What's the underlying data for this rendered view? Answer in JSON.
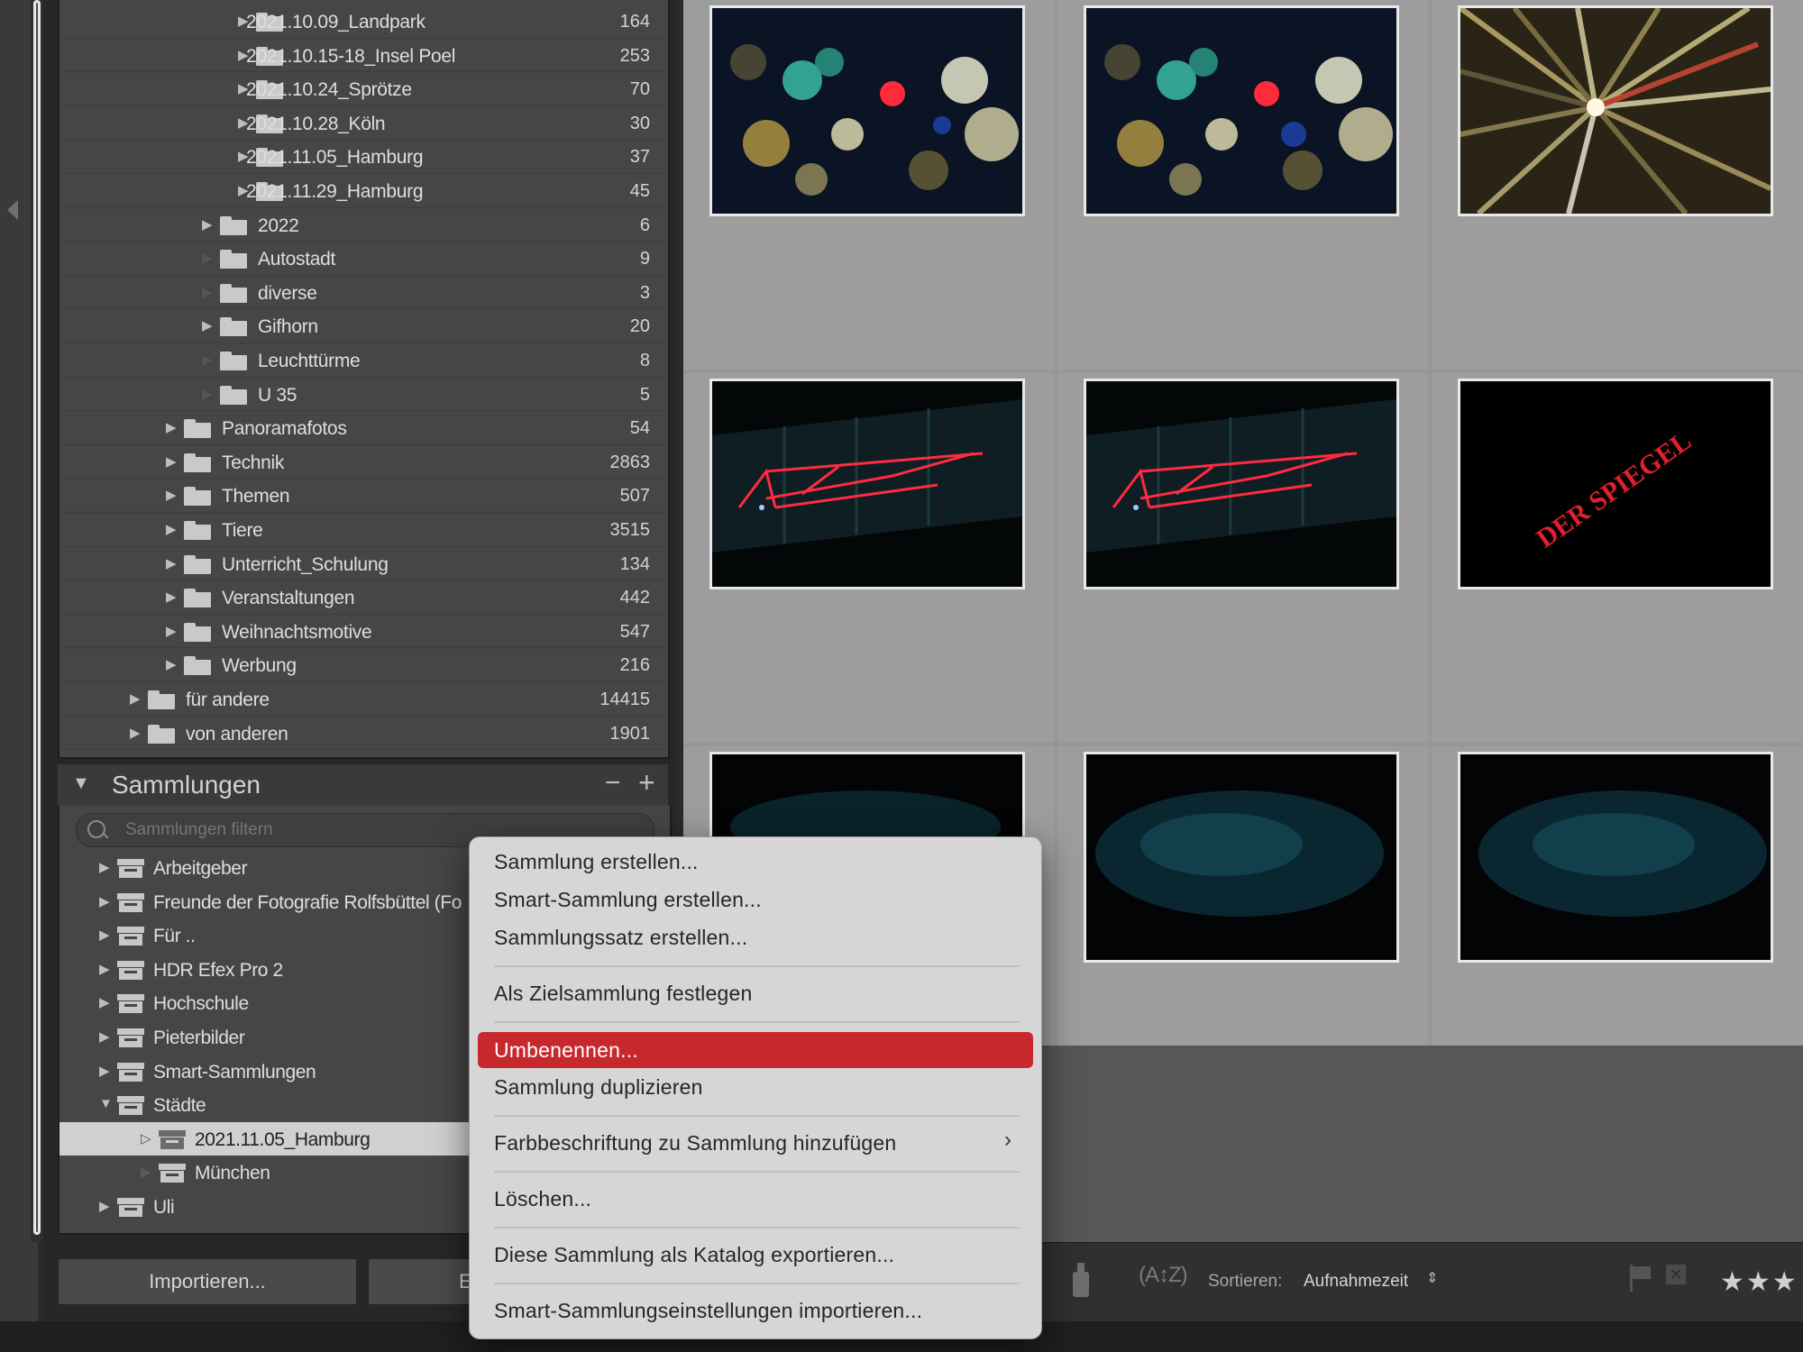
{
  "folders": [
    {
      "label": "2021.10.09_Landpark",
      "count": "164"
    },
    {
      "label": "2021.10.15-18_Insel Poel",
      "count": "253"
    },
    {
      "label": "2021.10.24_Sprötze",
      "count": "70"
    },
    {
      "label": "2021.10.28_Köln",
      "count": "30"
    },
    {
      "label": "2021.11.05_Hamburg",
      "count": "37"
    },
    {
      "label": "2021.11.29_Hamburg",
      "count": "45"
    },
    {
      "label": "2022",
      "count": "6"
    },
    {
      "label": "Autostadt",
      "count": "9"
    },
    {
      "label": "diverse",
      "count": "3"
    },
    {
      "label": "Gifhorn",
      "count": "20"
    },
    {
      "label": "Leuchttürme",
      "count": "8"
    },
    {
      "label": "U 35",
      "count": "5"
    },
    {
      "label": "Panoramafotos",
      "count": "54"
    },
    {
      "label": "Technik",
      "count": "2863"
    },
    {
      "label": "Themen",
      "count": "507"
    },
    {
      "label": "Tiere",
      "count": "3515"
    },
    {
      "label": "Unterricht_Schulung",
      "count": "134"
    },
    {
      "label": "Veranstaltungen",
      "count": "442"
    },
    {
      "label": "Weihnachtsmotive",
      "count": "547"
    },
    {
      "label": "Werbung",
      "count": "216"
    },
    {
      "label": "für andere",
      "count": "14415"
    },
    {
      "label": "von anderen",
      "count": "1901"
    }
  ],
  "collections_panel": {
    "title": "Sammlungen",
    "minus_label": "−",
    "plus_label": "+",
    "search_placeholder": "Sammlungen filtern",
    "items": [
      {
        "label": "Arbeitgeber"
      },
      {
        "label": "Freunde der Fotografie Rolfsbüttel (Fo"
      },
      {
        "label": "Für .."
      },
      {
        "label": "HDR Efex Pro 2"
      },
      {
        "label": "Hochschule"
      },
      {
        "label": "Pieterbilder"
      },
      {
        "label": "Smart-Sammlungen"
      },
      {
        "label": "Städte"
      },
      {
        "label": "2021.11.05_Hamburg"
      },
      {
        "label": "München"
      },
      {
        "label": "Uli"
      }
    ]
  },
  "buttons": {
    "import": "Importieren...",
    "export": "E"
  },
  "context_menu": {
    "items": [
      "Sammlung erstellen...",
      "Smart-Sammlung erstellen...",
      "Sammlungssatz erstellen...",
      "Als Zielsammlung festlegen",
      "Umbenennen...",
      "Sammlung duplizieren",
      "Farbbeschriftung zu Sammlung hinzufügen",
      "Löschen...",
      "Diese Sammlung als Katalog exportieren...",
      "Smart-Sammlungseinstellungen importieren..."
    ],
    "highlight_color": "#c7282d"
  },
  "toolbar": {
    "sort_label": "Sortieren:",
    "sort_value": "Aufnahmezeit",
    "sort_chevron": "⇕",
    "sort_icon": "(A↕Z)",
    "flag_reject": "✕",
    "stars": "★★★",
    "painter_icon": "spray-can-icon"
  },
  "thumbnails": [
    {
      "subject": "bokeh-city-lights-1"
    },
    {
      "subject": "bokeh-city-lights-2"
    },
    {
      "subject": "zoom-burst-lights"
    },
    {
      "subject": "red-neon-crane-1"
    },
    {
      "subject": "red-neon-crane-2"
    },
    {
      "subject": "der-spiegel-sign",
      "text": "DER SPIEGEL"
    },
    {
      "subject": "dark-water-1"
    },
    {
      "subject": "dark-water-2"
    },
    {
      "subject": "dark-water-3"
    }
  ]
}
